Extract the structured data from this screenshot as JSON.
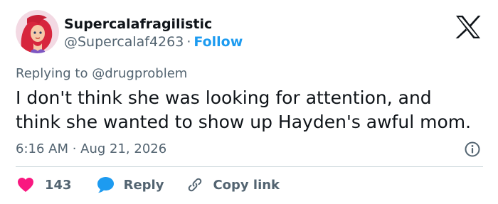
{
  "user": {
    "display_name": "Supercalafragilistic",
    "handle": "@Supercalaf4263",
    "separator": "·",
    "follow_label": "Follow"
  },
  "tweet": {
    "replying_to": "Replying to @drugproblem",
    "text_lines": [
      "I don't think she was looking for attention, and",
      "think she wanted to show up Hayden's awful mom."
    ],
    "timestamp": "6:16 AM · Aug 21, 2026"
  },
  "actions": {
    "like_count": "143",
    "reply_label": "Reply",
    "copy_link_label": "Copy link"
  },
  "icons": {
    "brand": "x-logo-icon",
    "info": "info-icon",
    "like": "heart-icon",
    "reply": "speech-bubble-icon",
    "copy": "link-icon"
  },
  "colors": {
    "text": "#0f1419",
    "secondary": "#536471",
    "accent": "#1d9bf0",
    "like": "#f91880",
    "divider": "#cfd9de"
  }
}
